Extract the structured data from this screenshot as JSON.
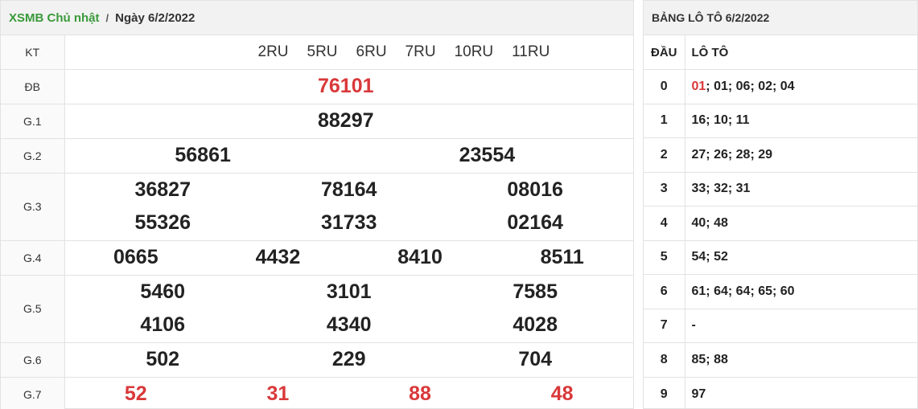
{
  "header": {
    "title_prefix": "XSMB Chủ nhật",
    "separator": "/",
    "date_label": "Ngày 6/2/2022"
  },
  "results": {
    "kt_label": "KT",
    "codes": [
      "2RU",
      "5RU",
      "6RU",
      "7RU",
      "10RU",
      "11RU"
    ],
    "db_label": "ĐB",
    "db": "76101",
    "g1_label": "G.1",
    "g1": "88297",
    "g2_label": "G.2",
    "g2": [
      "56861",
      "23554"
    ],
    "g3_label": "G.3",
    "g3_row1": [
      "36827",
      "78164",
      "08016"
    ],
    "g3_row2": [
      "55326",
      "31733",
      "02164"
    ],
    "g4_label": "G.4",
    "g4": [
      "0665",
      "4432",
      "8410",
      "8511"
    ],
    "g5_label": "G.5",
    "g5_row1": [
      "5460",
      "3101",
      "7585"
    ],
    "g5_row2": [
      "4106",
      "4340",
      "4028"
    ],
    "g6_label": "G.6",
    "g6": [
      "502",
      "229",
      "704"
    ],
    "g7_label": "G.7",
    "g7": [
      "52",
      "31",
      "88",
      "48"
    ]
  },
  "loto": {
    "title": "BẢNG LÔ TÔ 6/2/2022",
    "col_dau": "ĐẦU",
    "col_loto": "LÔ TÔ",
    "rows": [
      {
        "dau": "0",
        "first": "01",
        "rest": "; 01; 06; 02; 04"
      },
      {
        "dau": "1",
        "first": "",
        "rest": "16; 10; 11"
      },
      {
        "dau": "2",
        "first": "",
        "rest": "27; 26; 28; 29"
      },
      {
        "dau": "3",
        "first": "",
        "rest": "33; 32; 31"
      },
      {
        "dau": "4",
        "first": "",
        "rest": "40; 48"
      },
      {
        "dau": "5",
        "first": "",
        "rest": "54; 52"
      },
      {
        "dau": "6",
        "first": "",
        "rest": "61; 64; 64; 65; 60"
      },
      {
        "dau": "7",
        "first": "",
        "rest": "-"
      },
      {
        "dau": "8",
        "first": "",
        "rest": "85; 88"
      },
      {
        "dau": "9",
        "first": "",
        "rest": "97"
      }
    ]
  },
  "colors": {
    "green": "#3a9a3a",
    "red": "#d9383a"
  }
}
